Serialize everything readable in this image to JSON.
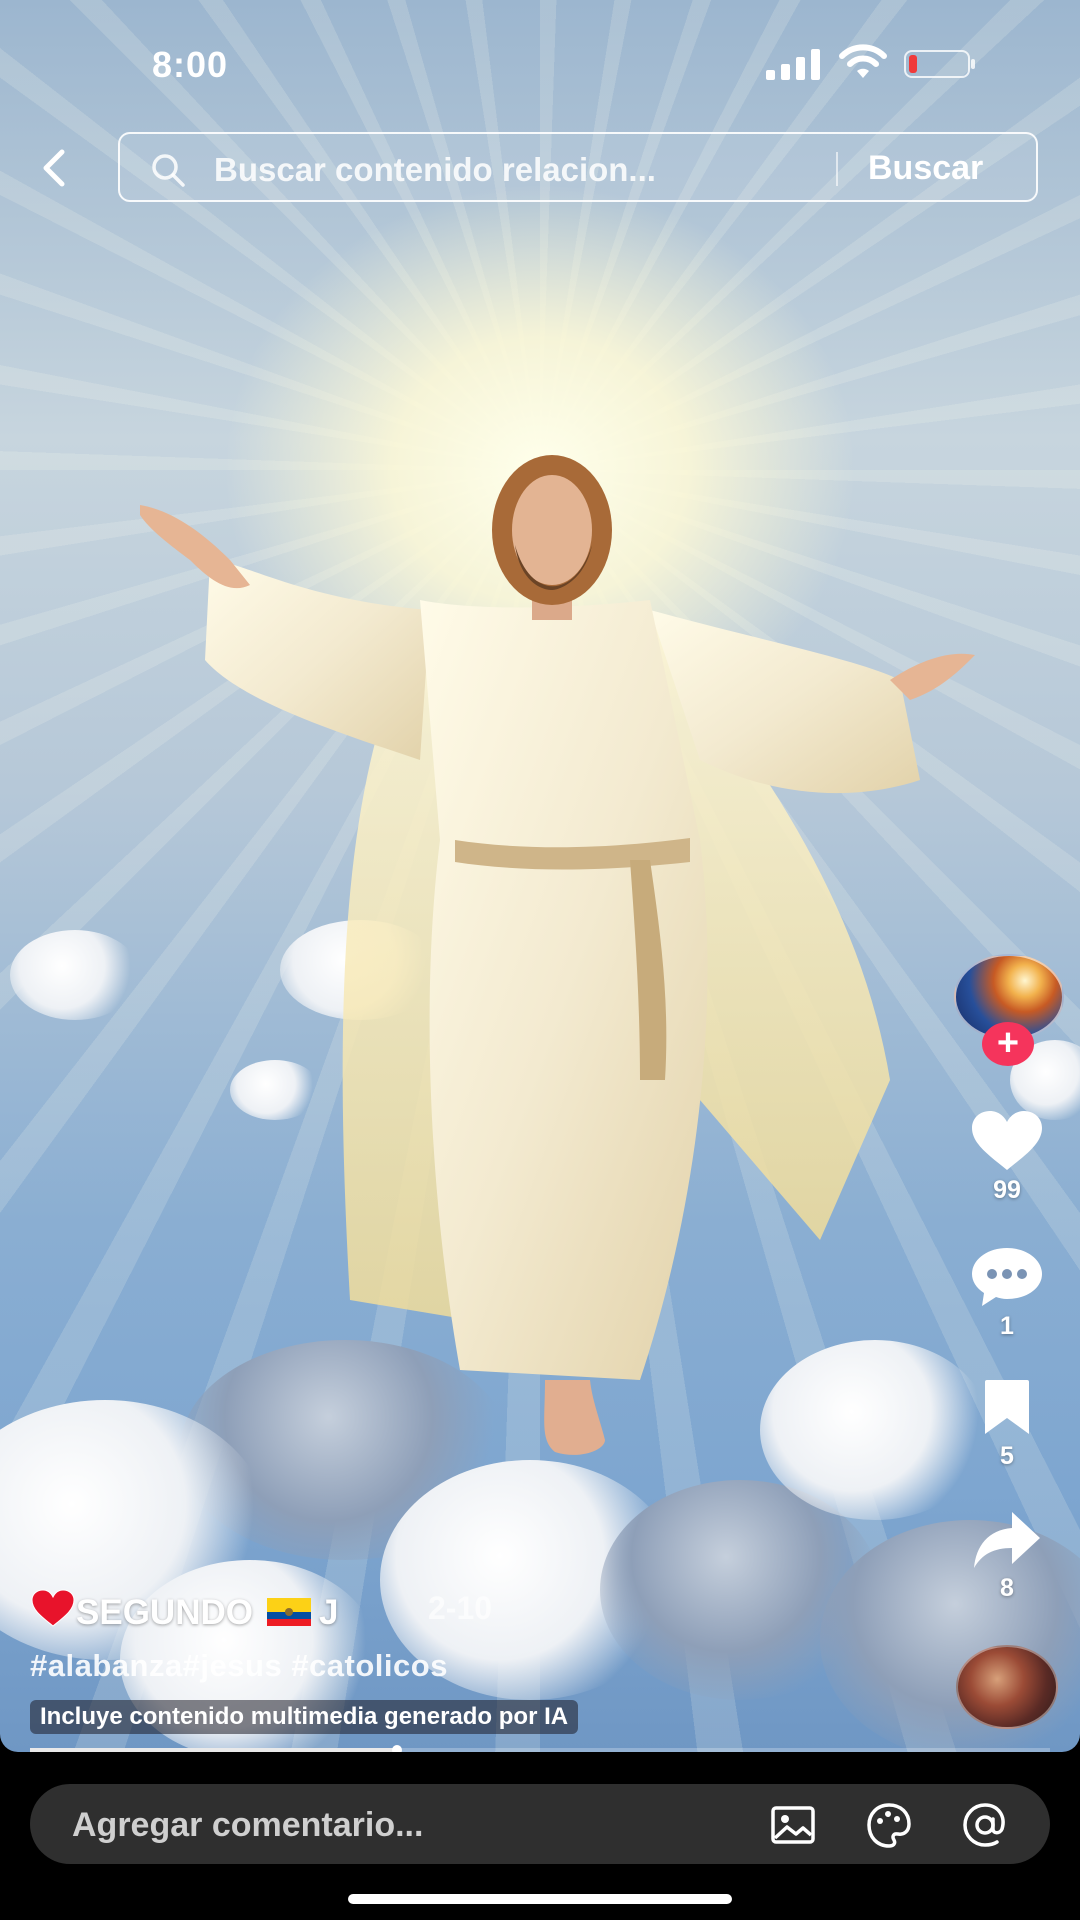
{
  "status_bar": {
    "time": "8:00"
  },
  "search": {
    "placeholder": "Buscar contenido relacion...",
    "button": "Buscar"
  },
  "rail": {
    "likes": "99",
    "comments": "1",
    "saves": "5",
    "shares": "8",
    "follow": "+"
  },
  "caption": {
    "author": "SEGUNDO",
    "author_suffix": "J",
    "date": "2-10",
    "hashtags": "#alabanza#jesus #catolicos",
    "ai_label": "Incluye contenido multimedia generado por IA"
  },
  "progress": {
    "played_fraction": 0.36
  },
  "comment_bar": {
    "placeholder": "Agregar comentario..."
  },
  "icons": [
    "back-icon",
    "search-icon",
    "heart-icon",
    "comment-icon",
    "bookmark-icon",
    "share-icon",
    "image-icon",
    "sticker-icon",
    "mention-icon"
  ]
}
